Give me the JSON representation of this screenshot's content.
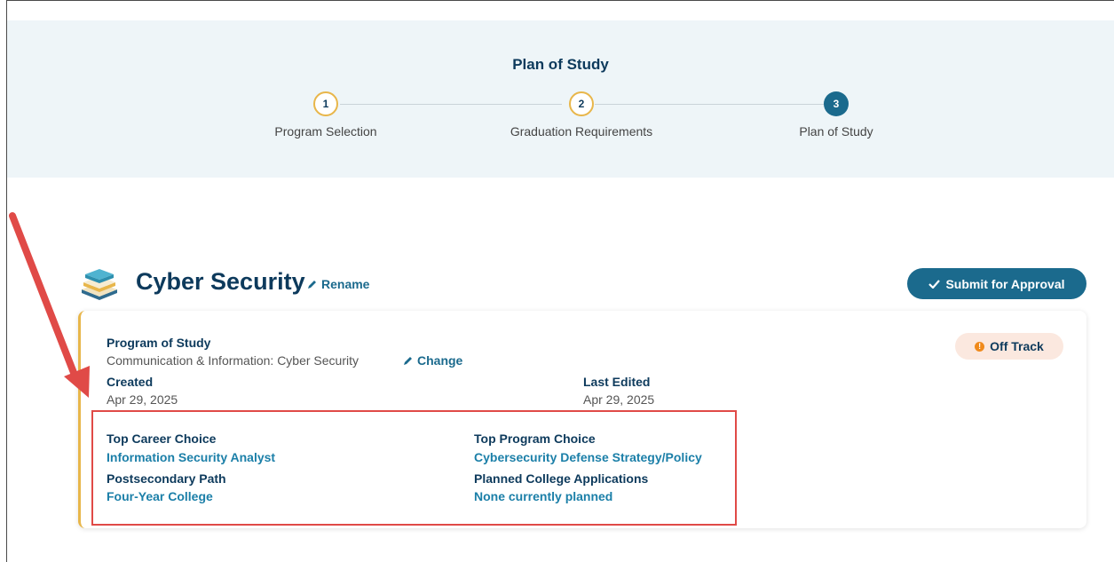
{
  "stepper": {
    "title": "Plan of Study",
    "steps": [
      {
        "number": "1",
        "label": "Program Selection"
      },
      {
        "number": "2",
        "label": "Graduation Requirements"
      },
      {
        "number": "3",
        "label": "Plan of Study"
      }
    ]
  },
  "plan": {
    "title": "Cyber Security",
    "rename_label": "Rename",
    "submit_label": "Submit for Approval"
  },
  "card": {
    "program_label": "Program of Study",
    "program_value": "Communication & Information: Cyber Security",
    "change_label": "Change",
    "created_label": "Created",
    "created_value": "Apr 29, 2025",
    "edited_label": "Last Edited",
    "edited_value": "Apr 29, 2025",
    "status": "Off Track",
    "top_career_label": "Top Career Choice",
    "top_career_value": "Information Security Analyst",
    "top_program_label": "Top Program Choice",
    "top_program_value": "Cybersecurity Defense Strategy/Policy",
    "path_label": "Postsecondary Path",
    "path_value": "Four-Year College",
    "applications_label": "Planned College Applications",
    "applications_value": "None currently planned"
  },
  "colors": {
    "brand": "#1b6a8d",
    "accent": "#e8b64a",
    "annotation": "#e04a47"
  }
}
